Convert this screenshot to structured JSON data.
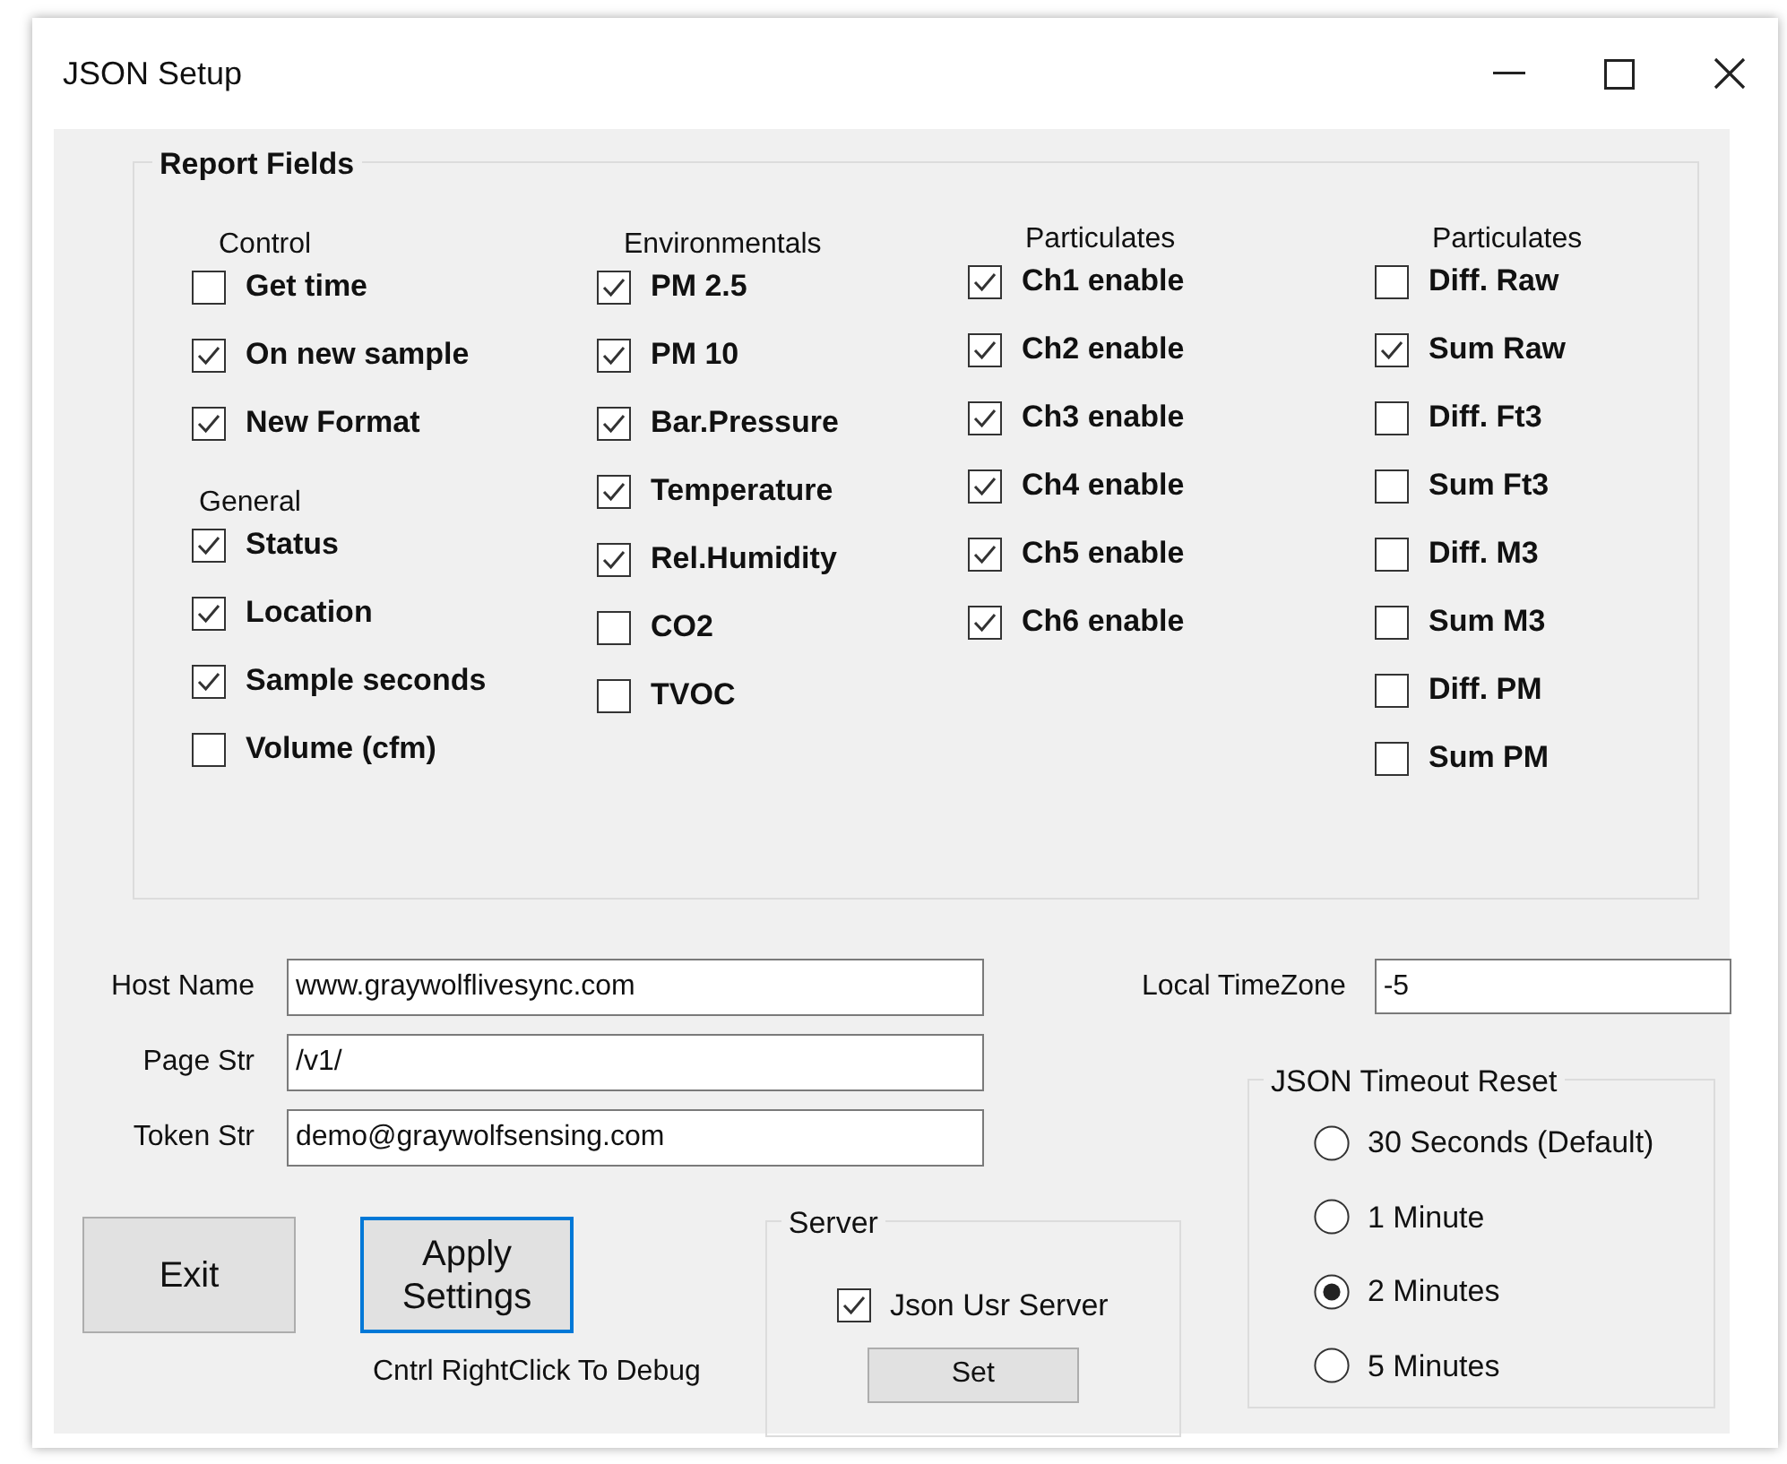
{
  "window": {
    "title": "JSON Setup"
  },
  "report_fields": {
    "title": "Report Fields",
    "columns": [
      {
        "sections": [
          {
            "heading": "Control",
            "items": [
              {
                "label": "Get time",
                "checked": false
              },
              {
                "label": "On new sample",
                "checked": true
              },
              {
                "label": "New Format",
                "checked": true
              }
            ]
          },
          {
            "heading": "General",
            "items": [
              {
                "label": "Status",
                "checked": true
              },
              {
                "label": "Location",
                "checked": true
              },
              {
                "label": "Sample seconds",
                "checked": true
              },
              {
                "label": "Volume (cfm)",
                "checked": false
              }
            ]
          }
        ]
      },
      {
        "sections": [
          {
            "heading": "Environmentals",
            "items": [
              {
                "label": "PM 2.5",
                "checked": true
              },
              {
                "label": "PM 10",
                "checked": true
              },
              {
                "label": "Bar.Pressure",
                "checked": true
              },
              {
                "label": "Temperature",
                "checked": true
              },
              {
                "label": "Rel.Humidity",
                "checked": true
              },
              {
                "label": "CO2",
                "checked": false
              },
              {
                "label": "TVOC",
                "checked": false
              }
            ]
          }
        ]
      },
      {
        "sections": [
          {
            "heading": "Particulates",
            "items": [
              {
                "label": "Ch1 enable",
                "checked": true
              },
              {
                "label": "Ch2 enable",
                "checked": true
              },
              {
                "label": "Ch3 enable",
                "checked": true
              },
              {
                "label": "Ch4 enable",
                "checked": true
              },
              {
                "label": "Ch5 enable",
                "checked": true
              },
              {
                "label": "Ch6 enable",
                "checked": true
              }
            ]
          }
        ]
      },
      {
        "sections": [
          {
            "heading": "Particulates",
            "items": [
              {
                "label": "Diff. Raw",
                "checked": false
              },
              {
                "label": "Sum Raw",
                "checked": true
              },
              {
                "label": "Diff. Ft3",
                "checked": false
              },
              {
                "label": "Sum Ft3",
                "checked": false
              },
              {
                "label": "Diff. M3",
                "checked": false
              },
              {
                "label": "Sum M3",
                "checked": false
              },
              {
                "label": "Diff. PM",
                "checked": false
              },
              {
                "label": "Sum PM",
                "checked": false
              }
            ]
          }
        ]
      }
    ]
  },
  "fields": [
    {
      "label": "Host Name",
      "value": "www.graywolflivesync.com"
    },
    {
      "label": "Page Str",
      "value": "/v1/"
    },
    {
      "label": "Token Str",
      "value": "demo@graywolfsensing.com"
    }
  ],
  "timezone": {
    "label": "Local TimeZone",
    "value": "-5"
  },
  "buttons": [
    {
      "label": "Exit",
      "focused": false
    },
    {
      "label": "Apply Settings",
      "focused": true
    }
  ],
  "debug_hint": "Cntrl RightClick To Debug",
  "server": {
    "title": "Server",
    "checkbox": {
      "label": "Json Usr Server",
      "checked": true
    },
    "button": "Set"
  },
  "timeout": {
    "title": "JSON Timeout Reset",
    "options": [
      {
        "label": "30 Seconds (Default)",
        "selected": false
      },
      {
        "label": "1 Minute",
        "selected": false
      },
      {
        "label": "2 Minutes",
        "selected": true
      },
      {
        "label": "5 Minutes",
        "selected": false
      }
    ]
  }
}
